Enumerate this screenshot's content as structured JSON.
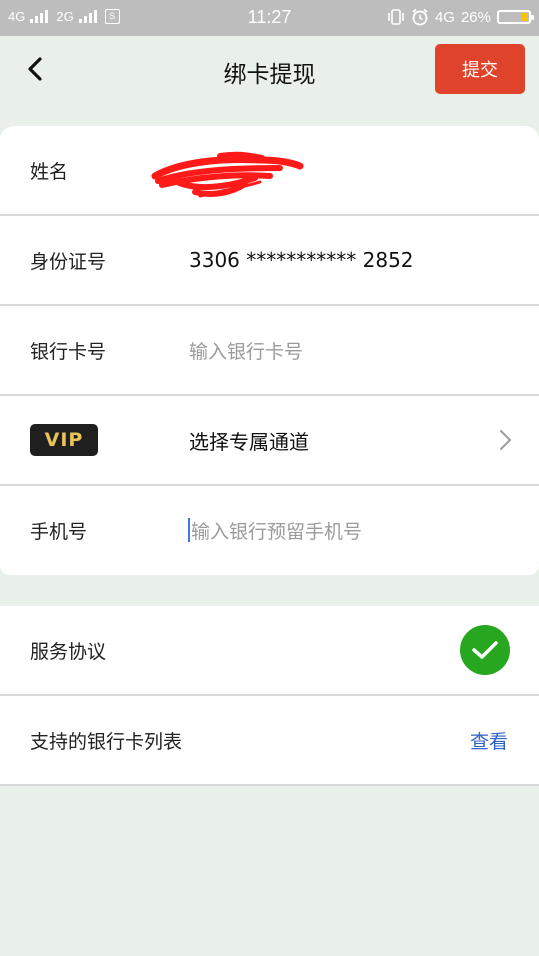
{
  "status_bar": {
    "net1": "4G",
    "net2": "2G",
    "sim_icon": "S",
    "time": "11:27",
    "net3": "4G",
    "battery_percent_text": "26%",
    "battery_level": 0.26
  },
  "header": {
    "title": "绑卡提现",
    "submit_label": "提交"
  },
  "form": {
    "name_label": "姓名",
    "id_label": "身份证号",
    "id_value": "3306 *********** 2852",
    "bank_label": "银行卡号",
    "bank_placeholder": "输入银行卡号",
    "vip_badge": "VIP",
    "vip_value": "选择专属通道",
    "phone_label": "手机号",
    "phone_placeholder": "输入银行预留手机号"
  },
  "list": {
    "agreement_label": "服务协议",
    "agreement_checked": true,
    "banks_label": "支持的银行卡列表",
    "banks_link": "查看"
  },
  "colors": {
    "accent_red": "#e0432b",
    "check_green": "#27a61f",
    "link_blue": "#2e62c6",
    "page_bg": "#e9f0ea"
  }
}
